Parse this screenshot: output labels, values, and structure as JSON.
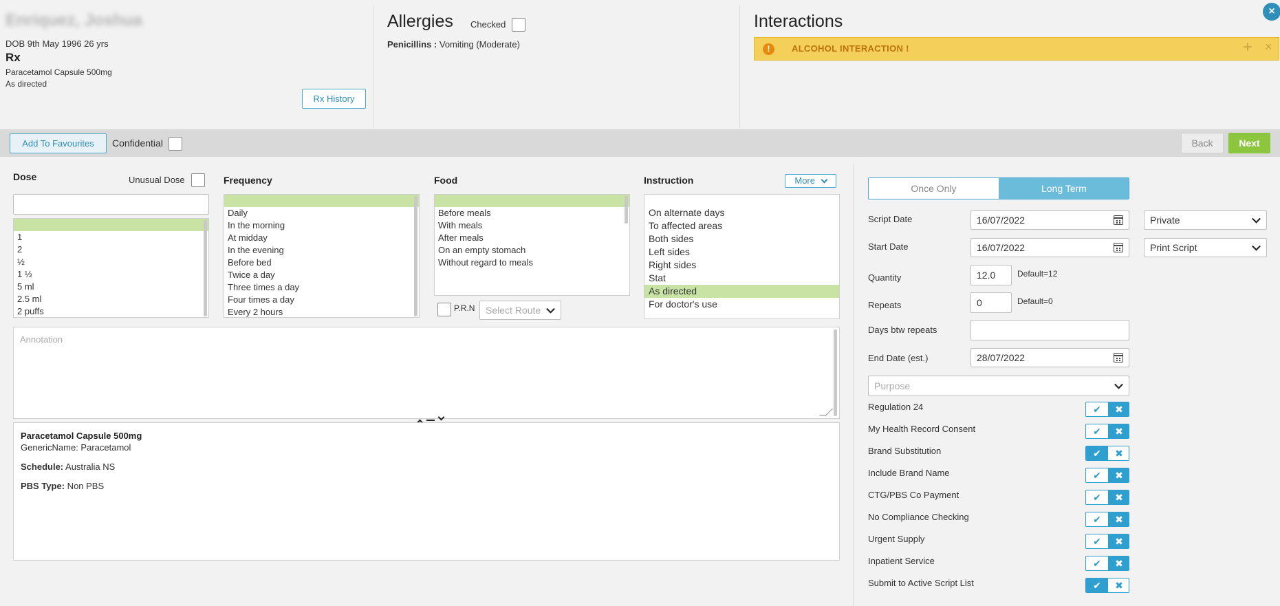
{
  "patient": {
    "name": "Enriquez, Joshua",
    "dob": "DOB 9th May 1996 26 yrs",
    "rx_title": "Rx",
    "drug": "Paracetamol Capsule 500mg",
    "directions": "As directed",
    "rx_history_label": "Rx History"
  },
  "allergies": {
    "title": "Allergies",
    "checked_label": "Checked",
    "item_name": "Penicillins :",
    "item_detail": " Vomiting (Moderate)"
  },
  "interactions": {
    "title": "Interactions",
    "alert_icon": "!",
    "alert_text": "ALCOHOL INTERACTION !",
    "alert_plus": "+",
    "alert_close": "×"
  },
  "close_icon": "×",
  "toolbar": {
    "favourites_label": "Add To Favourites",
    "confidential_label": "Confidential",
    "back_label": "Back",
    "next_label": "Next"
  },
  "dose": {
    "label": "Dose",
    "unusual_label": "Unusual Dose",
    "items": [
      "",
      "1",
      "2",
      "½",
      "1 ½",
      "5 ml",
      "2.5 ml",
      "2 puffs"
    ]
  },
  "frequency": {
    "label": "Frequency",
    "items": [
      "",
      "Daily",
      "In the morning",
      "At midday",
      "In the evening",
      "Before bed",
      "Twice a day",
      "Three times a day",
      "Four times a day",
      "Every 2 hours"
    ]
  },
  "food": {
    "label": "Food",
    "items": [
      "",
      "Before meals",
      "With meals",
      "After meals",
      "On an empty stomach",
      "Without regard to meals"
    ],
    "prn_label": "P.R.N",
    "route_placeholder": "Select Route"
  },
  "instruction": {
    "label": "Instruction",
    "more_label": "More",
    "items": [
      "",
      "On alternate days",
      "To affected areas",
      "Both sides",
      "Left sides",
      "Right sides",
      "Stat",
      "As directed",
      "For doctor's use"
    ],
    "selected_index": 7
  },
  "annotation_placeholder": "Annotation",
  "drug_info": {
    "name": "Paracetamol Capsule 500mg",
    "generic": "GenericName: Paracetamol",
    "schedule_label": "Schedule:",
    "schedule_value": " Australia NS",
    "pbs_label": "PBS Type:",
    "pbs_value": " Non PBS"
  },
  "script": {
    "once_only": "Once Only",
    "long_term": "Long Term",
    "script_date_label": "Script Date",
    "script_date": "16/07/2022",
    "start_date_label": "Start Date",
    "start_date": "16/07/2022",
    "quantity_label": "Quantity",
    "quantity": "12.0",
    "quantity_default": "Default=12",
    "repeats_label": "Repeats",
    "repeats": "0",
    "repeats_default": "Default=0",
    "days_btw_label": "Days btw repeats",
    "days_btw": "",
    "end_date_label": "End Date (est.)",
    "end_date": "28/07/2022",
    "purpose_placeholder": "Purpose",
    "private_label": "Private",
    "print_label": "Print Script"
  },
  "toggles": [
    {
      "label": "Regulation 24",
      "value": "off"
    },
    {
      "label": "My Health Record Consent",
      "value": "off"
    },
    {
      "label": "Brand Substitution",
      "value": "on"
    },
    {
      "label": "Include Brand Name",
      "value": "off"
    },
    {
      "label": "CTG/PBS Co Payment",
      "value": "off"
    },
    {
      "label": "No Compliance Checking",
      "value": "off"
    },
    {
      "label": "Urgent Supply",
      "value": "off"
    },
    {
      "label": "Inpatient Service",
      "value": "off"
    },
    {
      "label": "Submit to Active Script List",
      "value": "on"
    }
  ],
  "colors": {
    "accent_blue": "#2e9fcf",
    "next_green": "#8cc63f",
    "alert_yellow": "#f4cf5a",
    "selection_green": "#c8e3a3"
  }
}
